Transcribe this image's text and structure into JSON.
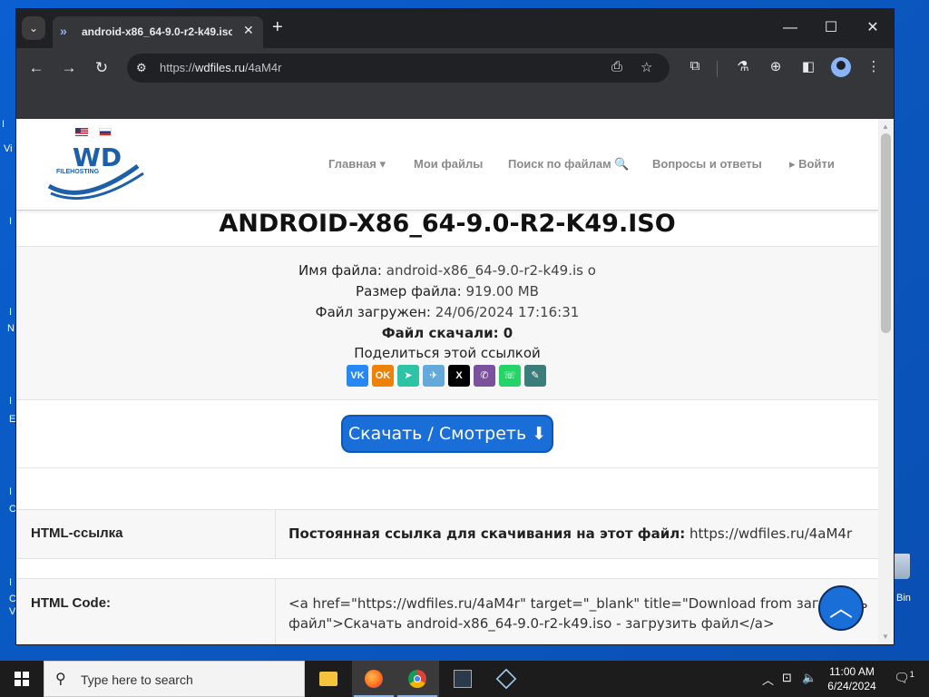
{
  "browser": {
    "tab_title": "android-x86_64-9.0-r2-k49.iso",
    "tab_dropdown": "⌄",
    "tab_close": "✕",
    "new_tab": "+",
    "url_scheme": "https://",
    "url_host": "wdfiles.ru",
    "url_path": "/4aM4r",
    "win_minimize": "—",
    "win_maximize": "☐",
    "win_close": "✕"
  },
  "site": {
    "logo_text": "WD",
    "logo_sub": "FILEHOSTING",
    "nav": [
      {
        "label": "Главная ▾"
      },
      {
        "label": "Мои файлы"
      },
      {
        "label": "Поиск по файлам 🔍"
      },
      {
        "label": "Вопросы и ответы"
      },
      {
        "label": "▸ Войти"
      }
    ]
  },
  "file": {
    "title": "ANDROID-X86_64-9.0-R2-K49.ISO",
    "name_label": "Имя файла:",
    "name_value": "android-x86_64-9.0-r2-k49.is o",
    "size_label": "Размер файла:",
    "size_value": "919.00 MB",
    "uploaded_label": "Файл загружен:",
    "uploaded_value": "24/06/2024 17:16:31",
    "downloads": "Файл скачали: 0",
    "share_label": "Поделиться этой ссылкой",
    "share_buttons": [
      {
        "label": "VK",
        "color": "#2787f5"
      },
      {
        "label": "OK",
        "color": "#ee8208"
      },
      {
        "label": "➤",
        "color": "#2dc4a6"
      },
      {
        "label": "✈",
        "color": "#64a9dc"
      },
      {
        "label": "X",
        "color": "#000000"
      },
      {
        "label": "✆",
        "color": "#7b519d"
      },
      {
        "label": "☏",
        "color": "#25d366"
      },
      {
        "label": "✎",
        "color": "#3a7d7a"
      }
    ],
    "download_button": "Скачать / Смотреть ⬇"
  },
  "links": {
    "html_link_label": "HTML-ссылка",
    "html_link_prefix": "Постоянная ссылка для скачивания на этот файл:",
    "html_link_value": "https://wdfiles.ru/4aM4r",
    "html_code_label": "HTML Code:",
    "html_code_line1": "<a href=\"https://wdfiles.ru/4aM4r\" target=\"_blank\" title=\"Download from загрузить",
    "html_code_line2": "файл\">Скачать android-x86_64-9.0-r2-k49.iso - загрузить файл</a>"
  },
  "desktop": {
    "recycle_label": "Bin"
  },
  "taskbar": {
    "search_placeholder": "Type here to search",
    "time": "11:00 AM",
    "date": "6/24/2024",
    "notification_count": "1"
  }
}
